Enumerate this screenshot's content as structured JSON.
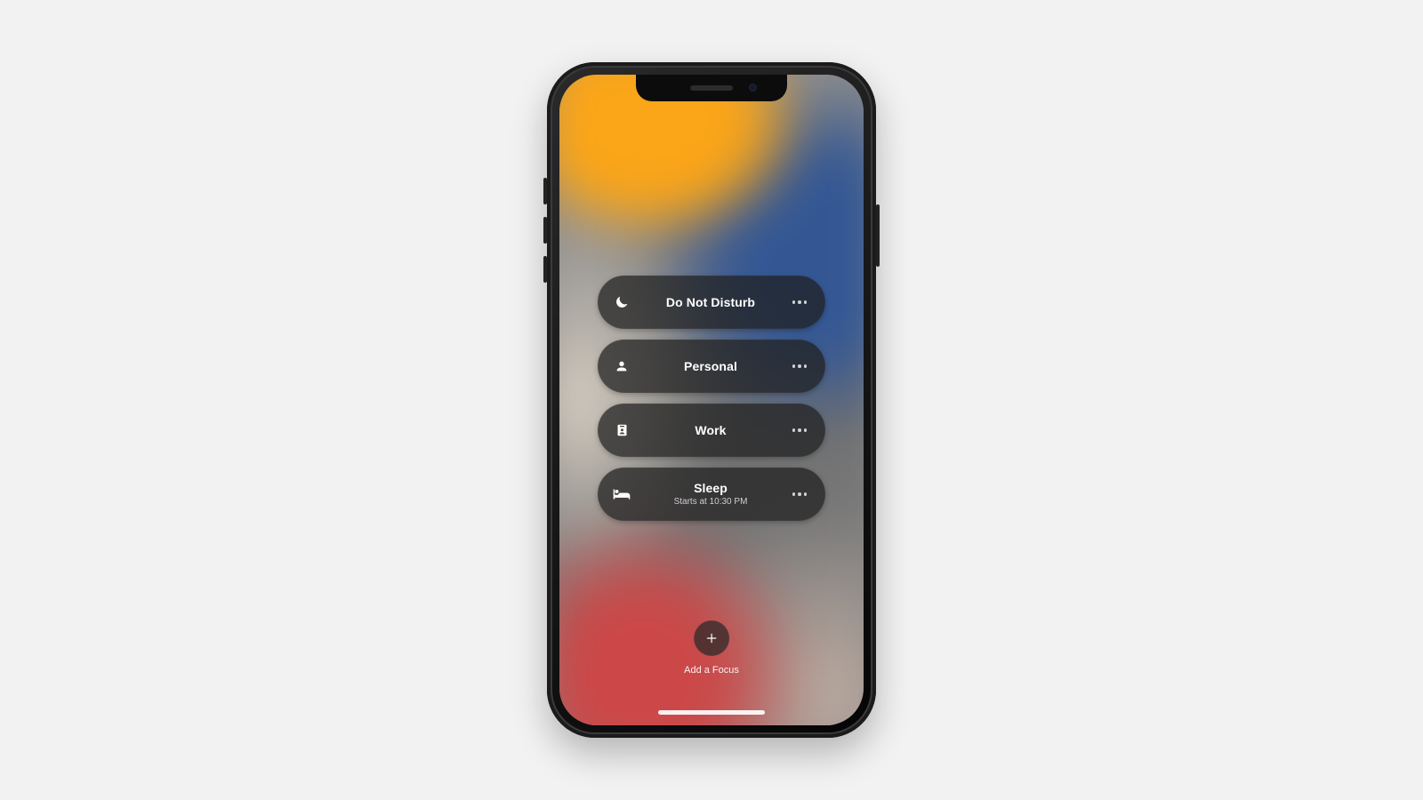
{
  "focus": {
    "items": [
      {
        "icon": "moon-icon",
        "label": "Do Not Disturb",
        "subtitle": ""
      },
      {
        "icon": "person-icon",
        "label": "Personal",
        "subtitle": ""
      },
      {
        "icon": "badge-icon",
        "label": "Work",
        "subtitle": ""
      },
      {
        "icon": "bed-icon",
        "label": "Sleep",
        "subtitle": "Starts at 10:30 PM"
      }
    ],
    "add_label": "Add a Focus"
  }
}
